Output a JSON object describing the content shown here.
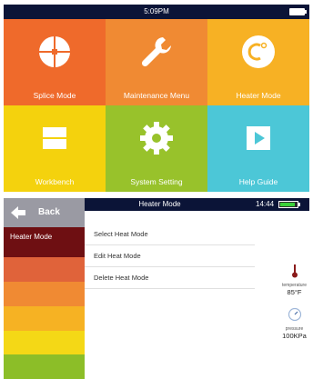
{
  "top_screen": {
    "status_time": "5:09PM",
    "tiles": [
      {
        "label": "Splice Mode",
        "icon": "crosshair-icon",
        "color": "#ef6a2b"
      },
      {
        "label": "Maintenance Menu",
        "icon": "wrench-icon",
        "color": "#f08a33"
      },
      {
        "label": "Heater Mode",
        "icon": "celsius-icon",
        "color": "#f7b124"
      },
      {
        "label": "Workbench",
        "icon": "workbench-icon",
        "color": "#f4d20d"
      },
      {
        "label": "System Setting",
        "icon": "gear-icon",
        "color": "#98c22b"
      },
      {
        "label": "Help Guide",
        "icon": "play-icon",
        "color": "#4cc7d7"
      }
    ]
  },
  "bottom_screen": {
    "back_label": "Back",
    "selected_item": "Heater Mode",
    "header_title": "Heater Mode",
    "header_time": "14:44",
    "menu": [
      "Select Heat Mode",
      "Edit Heat Mode",
      "Delete Heat Mode"
    ],
    "temperature": {
      "caption": "temperature",
      "value": "85°F",
      "icon": "thermometer-icon"
    },
    "pressure": {
      "caption": "pressure",
      "value": "100KPa",
      "icon": "gauge-icon"
    },
    "color_strips": [
      "#6e0f12",
      "#e0633a",
      "#f08a33",
      "#f6b223",
      "#f4d816",
      "#8cbe28",
      "#3fbfcf"
    ]
  }
}
